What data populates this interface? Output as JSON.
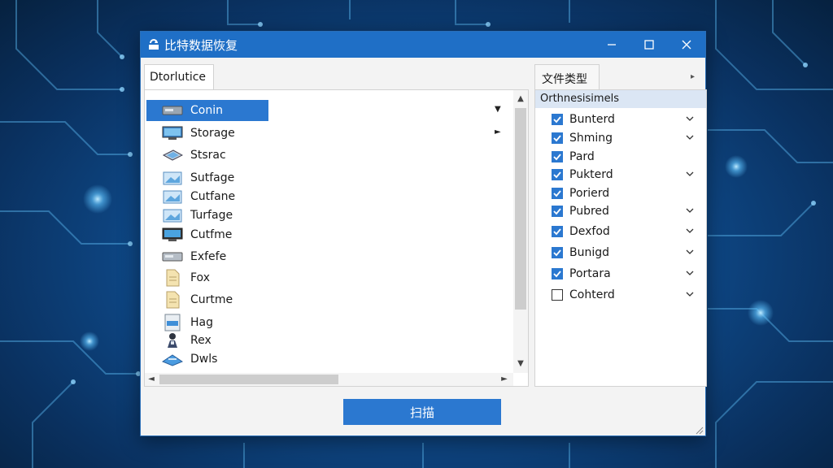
{
  "window": {
    "title": "比特数据恢复",
    "icon": "refresh-drive-icon",
    "controls": [
      "minimize-icon",
      "maximize-icon",
      "close-icon"
    ]
  },
  "left_panel": {
    "tab_label": "Dtorlutice",
    "items": [
      {
        "label": "Conin",
        "icon": "drive-icon",
        "selected": true
      },
      {
        "label": "Storage",
        "icon": "monitor-icon",
        "selected": false
      },
      {
        "label": "Stsrac",
        "icon": "disk-icon",
        "selected": false
      },
      {
        "label": "Sutfage",
        "icon": "image-folder-icon",
        "selected": false
      },
      {
        "label": "Cutfane",
        "icon": "image-folder-icon",
        "selected": false
      },
      {
        "label": "Turfage",
        "icon": "image-folder-icon",
        "selected": false
      },
      {
        "label": "Cutfme",
        "icon": "monitor-icon",
        "selected": false
      },
      {
        "label": "Exfefe",
        "icon": "drive-icon",
        "selected": false
      },
      {
        "label": "Fox",
        "icon": "document-icon",
        "selected": false
      },
      {
        "label": "Curtme",
        "icon": "document-icon",
        "selected": false
      },
      {
        "label": "Hag",
        "icon": "image-file-icon",
        "selected": false
      },
      {
        "label": "Rex",
        "icon": "person-icon",
        "selected": false
      },
      {
        "label": "Dwls",
        "icon": "network-drive-icon",
        "selected": false
      }
    ]
  },
  "right_panel": {
    "tab_label": "文件类型",
    "group_header": "Orthnesisimels",
    "items": [
      {
        "label": "Bunterd",
        "checked": true,
        "expandable": true
      },
      {
        "label": "Shming",
        "checked": true,
        "expandable": true
      },
      {
        "label": "Pard",
        "checked": true,
        "expandable": false
      },
      {
        "label": "Pukterd",
        "checked": true,
        "expandable": true
      },
      {
        "label": "Porierd",
        "checked": true,
        "expandable": false
      },
      {
        "label": "Pubred",
        "checked": true,
        "expandable": true
      },
      {
        "label": "Dexfod",
        "checked": true,
        "expandable": true
      },
      {
        "label": "Bunigd",
        "checked": true,
        "expandable": true
      },
      {
        "label": "Portara",
        "checked": true,
        "expandable": true
      },
      {
        "label": "Cohterd",
        "checked": false,
        "expandable": true
      }
    ]
  },
  "actions": {
    "scan_label": "扫描"
  },
  "colors": {
    "accent": "#2b78d0",
    "titlebar": "#1f6fc6",
    "background": "#0f4d8f"
  }
}
